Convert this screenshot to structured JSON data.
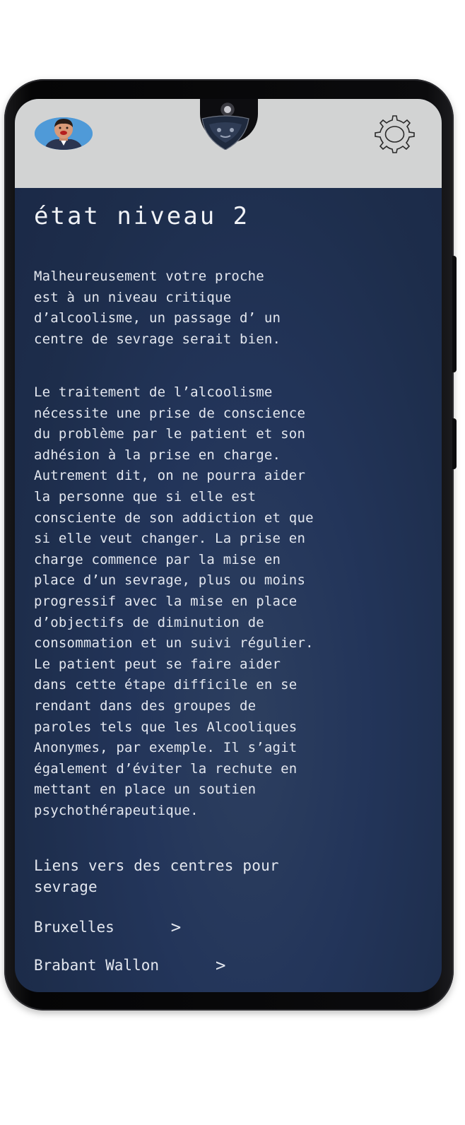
{
  "header": {
    "avatar_icon": "user-avatar-icon",
    "logo_icon": "shield-logo-icon",
    "settings_icon": "gear-icon"
  },
  "page": {
    "title": "état niveau 2",
    "intro": "Malheureusement votre proche\nest à un niveau critique\nd’alcoolisme, un passage d’ un\ncentre de sevrage serait bien.",
    "body": "Le traitement de l’alcoolisme\nnécessite une prise de conscience\ndu problème par le patient et son\nadhésion à la prise en charge.\nAutrement dit, on ne pourra aider\nla personne que si elle est\nconsciente de son addiction et que\nsi elle veut changer. La prise en\ncharge commence par la mise en\nplace d’un sevrage, plus ou moins\nprogressif avec la mise en place\nd’objectifs de diminution de\nconsommation et un suivi régulier.\nLe patient peut se faire aider\ndans cette étape difficile en se\nrendant dans des groupes de\nparoles tels que les Alcooliques\nAnonymes, par exemple. Il s’agit\négalement d’éviter la rechute en\nmettant en place un soutien\npsychothérapeutique.",
    "links_heading": "Liens vers des centres pour\nsevrage",
    "links": [
      {
        "label": "Bruxelles",
        "chevron": ">"
      },
      {
        "label": "Brabant Wallon",
        "chevron": ">"
      }
    ]
  },
  "colors": {
    "header_bg": "#d2d3d3",
    "screen_bg": "#1f2f4e",
    "text": "#e3e7ef",
    "avatar_bg": "#4f9ad8"
  }
}
